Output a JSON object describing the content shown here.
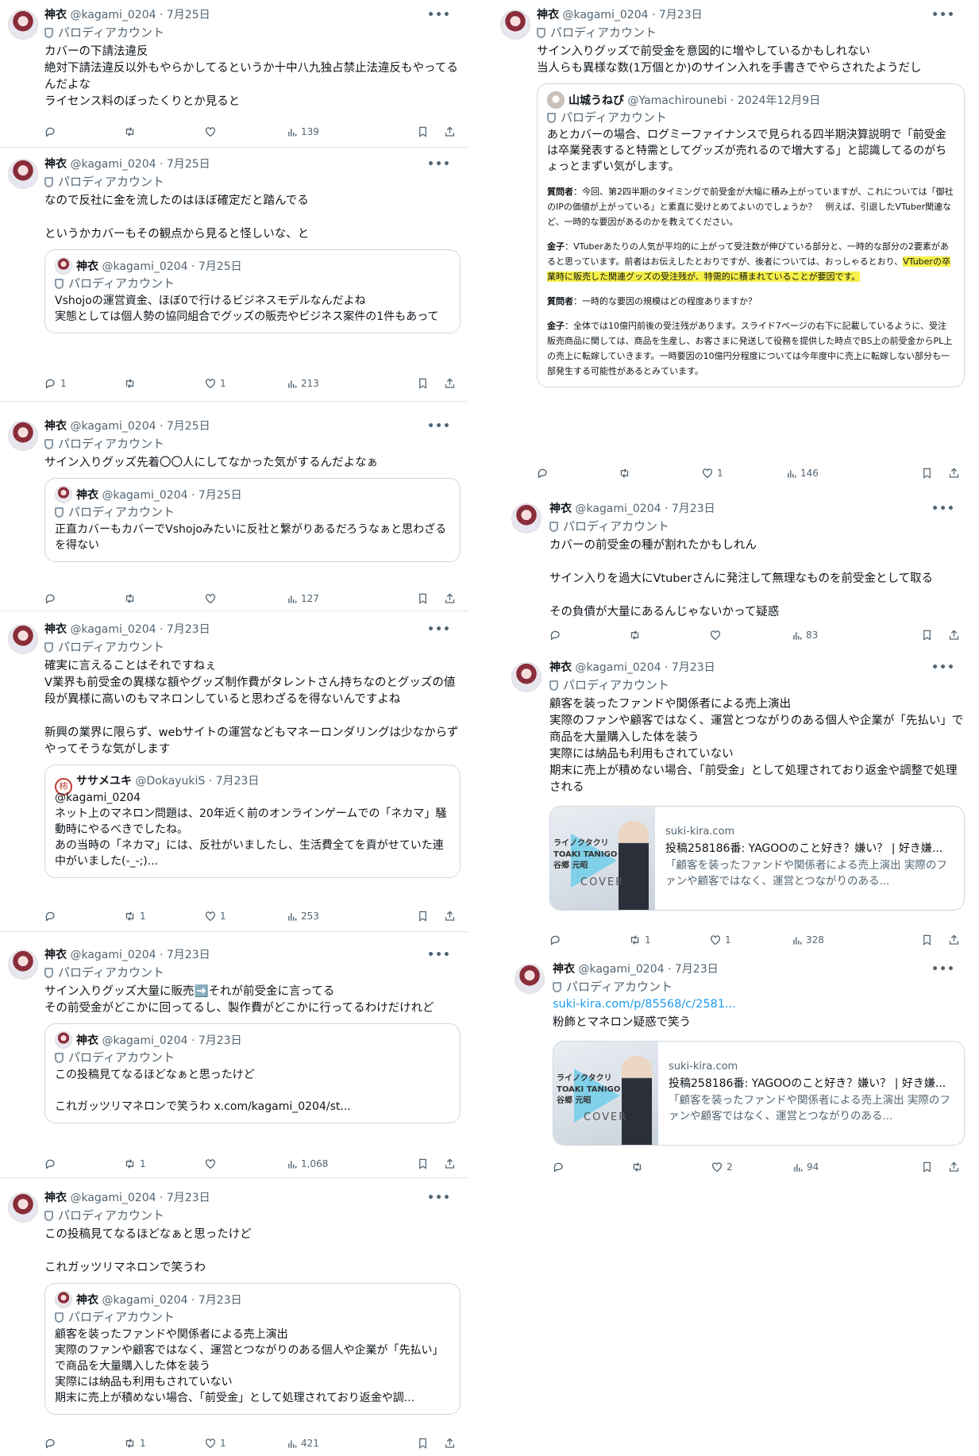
{
  "left": [
    {
      "name": "神衣",
      "handle": "@kagami_0204",
      "date": "7月25日",
      "parody": "パロディアカウント",
      "text": "カバーの下請法違反\n絶対下請法違反以外もやらかしてるというか十中八九独占禁止法違反もやってるんだよな\nライセンス料のぼったくりとか見ると",
      "replies": "",
      "reposts": "",
      "likes": "",
      "views": "139"
    },
    {
      "name": "神衣",
      "handle": "@kagami_0204",
      "date": "7月25日",
      "parody": "パロディアカウント",
      "text": "なので反社に金を流したのはほぼ確定だと踏んでる\n\nというかカバーもその観点から見ると怪しいな、と",
      "quote": {
        "name": "神衣",
        "handle": "@kagami_0204",
        "date": "7月25日",
        "parody": "パロディアカウント",
        "text": "Vshojoの運営資金、ほぼ0で行けるビジネスモデルなんだよね\n実態としては個人勢の協同組合でグッズの販売やビジネス案件の1件もあって"
      },
      "replies": "1",
      "reposts": "",
      "likes": "1",
      "views": "213"
    },
    {
      "name": "神衣",
      "handle": "@kagami_0204",
      "date": "7月25日",
      "parody": "パロディアカウント",
      "text": "サイン入りグッズ先着〇〇人にしてなかった気がするんだよなぁ",
      "quote": {
        "name": "神衣",
        "handle": "@kagami_0204",
        "date": "7月25日",
        "parody": "パロディアカウント",
        "text": "正直カバーもカバーでVshojoみたいに反社と繋がりあるだろうなぁと思わざるを得ない"
      },
      "replies": "",
      "reposts": "",
      "likes": "",
      "views": "127"
    },
    {
      "name": "神衣",
      "handle": "@kagami_0204",
      "date": "7月23日",
      "parody": "パロディアカウント",
      "text": "確実に言えることはそれですねぇ\nV業界も前受金の異様な額やグッズ制作費がタレントさん持ちなのとグッズの値段が異様に高いのもマネロンしていると思わざるを得ないんですよね\n\n新興の業界に限らず、webサイトの運営などもマネーロンダリングは少なからずやってそうな気がします",
      "quote": {
        "name": "ササメユキ",
        "handle": "@DokayukiS",
        "date": "7月23日",
        "parody": "",
        "text": "@kagami_0204\nネット上のマネロン問題は、20年近く前のオンラインゲームでの「ネカマ」騒動時にやるべきでしたね。\nあの当時の「ネカマ」には、反社がいましたし、生活費全てを貢がせていた連中がいました(-_-;)..."
      },
      "replies": "",
      "reposts": "1",
      "likes": "1",
      "views": "253"
    },
    {
      "name": "神衣",
      "handle": "@kagami_0204",
      "date": "7月23日",
      "parody": "パロディアカウント",
      "text": "サイン入りグッズ大量に販売➡️それが前受金に言ってる\nその前受金がどこかに回ってるし、製作費がどこかに行ってるわけだけれど",
      "quote": {
        "name": "神衣",
        "handle": "@kagami_0204",
        "date": "7月23日",
        "parody": "パロディアカウント",
        "text": "この投稿見てなるほどなぁと思ったけど\n\nこれガッツリマネロンで笑うわ x.com/kagami_0204/st..."
      },
      "replies": "",
      "reposts": "1",
      "likes": "",
      "views": "1,068"
    },
    {
      "name": "神衣",
      "handle": "@kagami_0204",
      "date": "7月23日",
      "parody": "パロディアカウント",
      "text": "この投稿見てなるほどなぁと思ったけど\n\nこれガッツリマネロンで笑うわ",
      "quote": {
        "name": "神衣",
        "handle": "@kagami_0204",
        "date": "7月23日",
        "parody": "パロディアカウント",
        "text": "顧客を装ったファンドや関係者による売上演出\n実際のファンや顧客ではなく、運営とつながりのある個人や企業が「先払い」で商品を大量購入した体を装う\n実際には納品も利用もされていない\n期末に売上が積めない場合、「前受金」として処理されており返金や調..."
      },
      "replies": "",
      "reposts": "1",
      "likes": "1",
      "views": "421"
    }
  ],
  "right": {
    "p1": {
      "name": "神衣",
      "handle": "@kagami_0204",
      "date": "7月23日",
      "parody": "パロディアカウント",
      "text": "サイン入りグッズで前受金を意図的に増やしているかもしれない\n当人らも異様な数(1万個とか)のサイン入れを手書きでやらされたようだし",
      "quote": {
        "name": "山城うねび",
        "handle": "@Yamachirounebi",
        "date": "2024年12月9日",
        "parody": "パロディアカウント",
        "text": "あとカバーの場合、ログミーファイナンスで見られる四半期決算説明で「前受金は卒業発表すると特需としてグッズが売れるので増大する」と認識してるのがちょっとまずい気がします。",
        "q1_label": "質問者",
        "q1": "：今回、第2四半期のタイミングで前受金が大幅に積み上がっていますが、これについては「御社のIPの価値が上がっている」と素直に受けとめてよいのでしょうか？　例えば、引退したVTuber関連など、一時的な要因があるのかを教えてください。",
        "a1_label": "金子",
        "a1_pre": "：VTuberあたりの人気が平均的に上がって受注数が伸びている部分と、一時的な部分の2要素があると思っています。前者はお伝えしたとおりですが、後者については、おっしゃるとおり、",
        "a1_hl": "VTuberの卒業時に販売した関連グッズの受注残が、特需的に積まれていることが要因です。",
        "q2_label": "質問者",
        "q2": "：一時的な要因の規模はどの程度ありますか？",
        "a2_label": "金子",
        "a2": "：全体では10億円前後の受注残があります。スライド7ページの右下に記載しているように、受注販売商品に関しては、商品を生産し、お客さまに発送して役務を提供した時点でBS上の前受金からPL上の売上に転嫁していきます。一時要因の10億円分程度については今年度中に売上に転嫁しない部分も一部発生する可能性があるとみています。"
      },
      "replies": "",
      "reposts": "",
      "likes": "1",
      "views": "146"
    },
    "p2": {
      "name": "神衣",
      "handle": "@kagami_0204",
      "date": "7月23日",
      "parody": "パロディアカウント",
      "text": "カバーの前受金の種が割れたかもしれん\n\nサイン入りを過大にVtuberさんに発注して無理なものを前受金として取る\n\nその負債が大量にあるんじゃないかって疑惑",
      "replies": "",
      "reposts": "",
      "likes": "",
      "views": "83"
    },
    "p3": {
      "name": "神衣",
      "handle": "@kagami_0204",
      "date": "7月23日",
      "parody": "パロディアカウント",
      "text": "顧客を装ったファンドや関係者による売上演出\n実際のファンや顧客ではなく、運営とつながりのある個人や企業が「先払い」で商品を大量購入した体を装う\n実際には納品も利用もされていない\n期末に売上が積めない場合、「前受金」として処理されており返金や調整で処理される",
      "card": {
        "domain": "suki-kira.com",
        "title": "投稿258186番: YAGOOのこと好き？嫌い？ | 好き嫌...",
        "desc": "「顧客を装ったファンドや関係者による売上演出 実際のファンや顧客ではなく、運営とつながりのある...",
        "img_jp": "ライノクタクリ\nTOAKI TANIGO\n谷郷 元昭",
        "img_cover": "COVER"
      },
      "replies": "",
      "reposts": "1",
      "likes": "1",
      "views": "328"
    },
    "p4": {
      "name": "神衣",
      "handle": "@kagami_0204",
      "date": "7月23日",
      "parody": "パロディアカウント",
      "link": "suki-kira.com/p/85568/c/2581...",
      "text": "粉飾とマネロン疑惑で笑う",
      "card": {
        "domain": "suki-kira.com",
        "title": "投稿258186番: YAGOOのこと好き？嫌い？ | 好き嫌...",
        "desc": "「顧客を装ったファンドや関係者による売上演出 実際のファンや顧客ではなく、運営とつながりのある...",
        "img_jp": "ライノクタクリ\nTOAKI TANIGO\n谷郷 元昭",
        "img_cover": "COVER"
      },
      "replies": "",
      "reposts": "",
      "likes": "2",
      "views": "94"
    }
  },
  "icons": {
    "more": "•••",
    "reply": "reply-icon",
    "repost": "repost-icon",
    "like": "heart-icon",
    "views": "views-icon",
    "bookmark": "bookmark-icon",
    "share": "share-icon"
  },
  "colors": {
    "text": "#0f1419",
    "muted": "#536471",
    "link": "#1d9bf0",
    "border": "#cfd9de",
    "highlight": "#f6f04a"
  }
}
